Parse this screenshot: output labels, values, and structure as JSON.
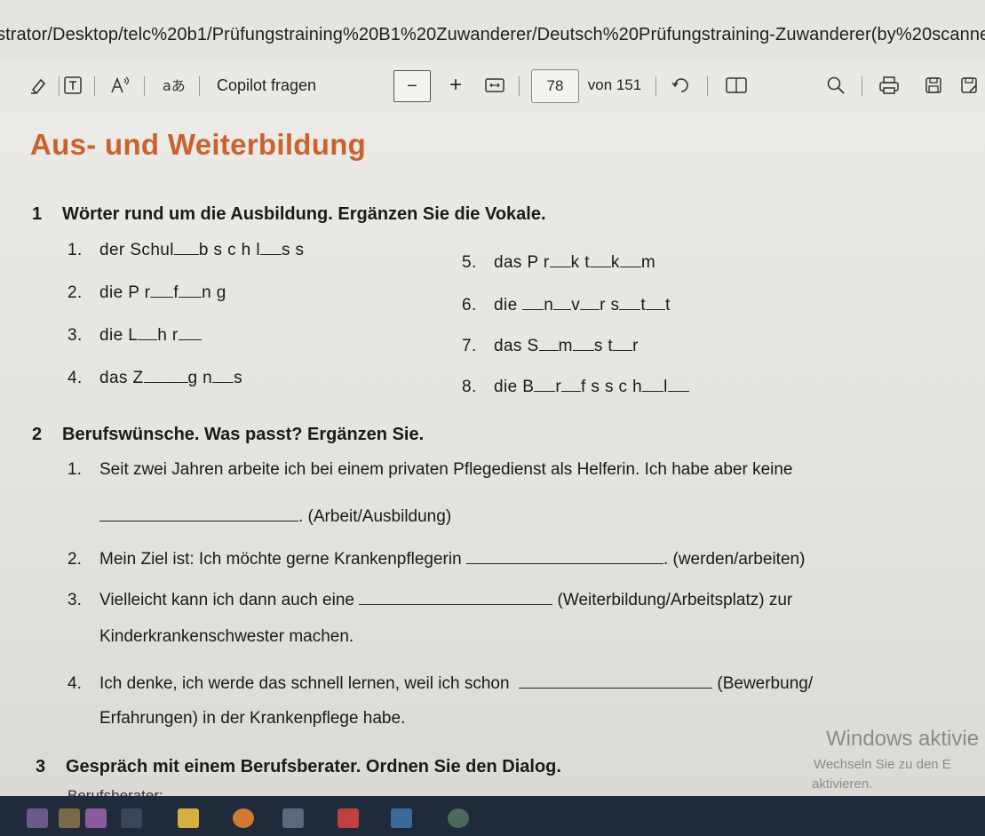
{
  "browser": {
    "url": "strator/Desktop/telc%20b1/Prüfungstraining%20B1%20Zuwanderer/Deutsch%20Prüfungstraining-Zuwanderer(by%20scanner).pdf"
  },
  "toolbar": {
    "copilot_label": "Copilot fragen",
    "minus": "−",
    "plus": "+",
    "page_current": "78",
    "page_total": "von 151",
    "icons": [
      "highlight-icon",
      "text-box-icon",
      "read-aloud-icon",
      "translate-icon",
      "fit-page-icon",
      "rotate-icon",
      "page-view-icon",
      "search-icon",
      "print-icon",
      "save-icon",
      "save-as-icon"
    ]
  },
  "document": {
    "title": "Aus- und Weiterbildung",
    "ex1": {
      "num": "1",
      "title": "Wörter rund um die Ausbildung. Ergänzen Sie die Vokale.",
      "left": [
        {
          "n": "1.",
          "parts": [
            "der  Schul",
            "b s c h l",
            "s s"
          ]
        },
        {
          "n": "2.",
          "parts": [
            "die  P r",
            "f",
            "n g"
          ]
        },
        {
          "n": "3.",
          "parts": [
            "die  L",
            "h r",
            ""
          ]
        },
        {
          "n": "4.",
          "parts": [
            "das  Z",
            "g n",
            "s"
          ]
        }
      ],
      "right": [
        {
          "n": "5.",
          "parts": [
            "das  P r",
            "k t",
            "k",
            "m"
          ]
        },
        {
          "n": "6.",
          "parts": [
            "die  ",
            "n",
            "v",
            "r s",
            "t",
            "t"
          ]
        },
        {
          "n": "7.",
          "parts": [
            "das  S",
            "m",
            "s t",
            "r"
          ]
        },
        {
          "n": "8.",
          "parts": [
            "die  B",
            "r",
            "f s s c h",
            "l",
            ""
          ]
        }
      ]
    },
    "ex2": {
      "num": "2",
      "title": "Berufswünsche. Was passt? Ergänzen Sie.",
      "s1_line1": "Seit zwei Jahren arbeite ich bei einem privaten Pflegedienst als Helferin. Ich habe aber keine",
      "s1_line2": ". (Arbeit/Ausbildung)",
      "s2_a": "Mein Ziel ist: Ich möchte gerne Krankenpflegerin",
      "s2_b": ". (werden/arbeiten)",
      "s3_a": "Vielleicht kann ich dann auch eine",
      "s3_b": "(Weiterbildung/Arbeitsplatz) zur",
      "s3_line2": "Kinderkrankenschwester machen.",
      "s4_a": "Ich denke, ich werde das schnell lernen, weil ich schon",
      "s4_b": "(Bewerbung/",
      "s4_line2": "Erfahrungen) in der Krankenpflege habe.",
      "nums": [
        "1.",
        "2.",
        "3.",
        "4."
      ]
    },
    "ex3": {
      "num": "3",
      "title": "Gespräch mit einem Berufsberater. Ordnen Sie den Dialog.",
      "cut": "Berufsberater:"
    }
  },
  "watermark": {
    "line1": "Windows aktivie",
    "line2": "Wechseln Sie zu den E",
    "line3": "aktivieren."
  },
  "colors": {
    "title": "#c9622c",
    "taskbar": "#1f2a3a"
  }
}
